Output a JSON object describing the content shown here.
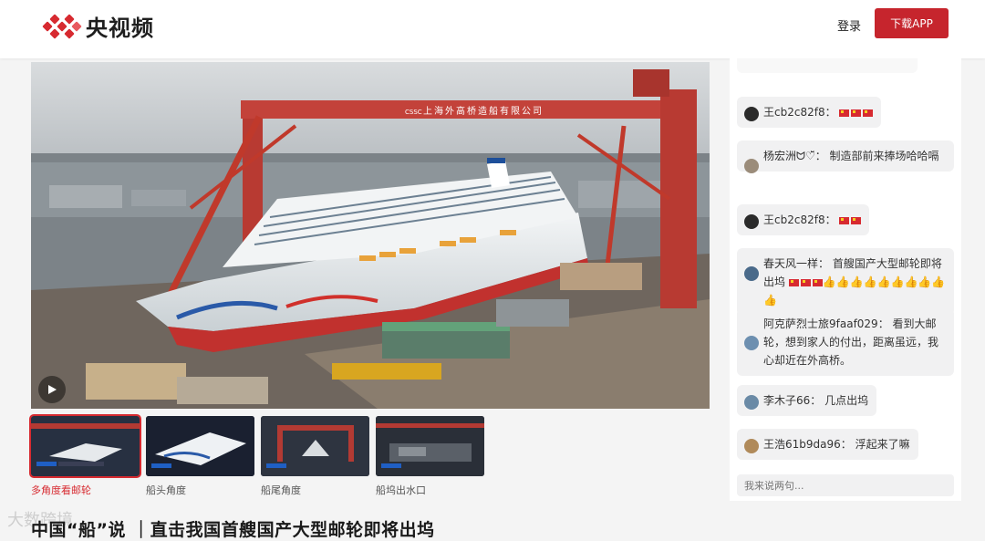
{
  "header": {
    "logo_text": "央视频",
    "login_label": "登录",
    "download_label": "下载APP"
  },
  "player": {
    "sign_text": "上海外高桥造船有限公司",
    "cssc_text": "CSSC"
  },
  "thumbnails": [
    {
      "caption": "多角度看邮轮",
      "active": true
    },
    {
      "caption": "船头角度",
      "active": false
    },
    {
      "caption": "船尾角度",
      "active": false
    },
    {
      "caption": "船坞出水口",
      "active": false
    }
  ],
  "video_title": "中国“船”说 ｜直击我国首艘国产大型邮轮即将出坞",
  "watermark": "大数跨境",
  "chat": {
    "top_partial": "",
    "messages": [
      {
        "user": "王cb2c82f8：",
        "text": "",
        "flags": 3,
        "thumbs": 0
      },
      {
        "user": "杨宏洲ᗢ♡̆̈：",
        "text": "制造部前来捧场哈哈嗝",
        "flags": 0,
        "thumbs": 0
      },
      {
        "user": "王cb2c82f8：",
        "text": "",
        "flags": 2,
        "thumbs": 0
      },
      {
        "user": "春天风一样：",
        "text": "首艘国产大型邮轮即将出坞",
        "flags": 3,
        "thumbs": 10
      },
      {
        "user": "阿克萨烈士旅9faaf029：",
        "text": "看到大邮轮，想到家人的付出，距离虽远，我心却近在外高桥。",
        "flags": 0,
        "thumbs": 0
      },
      {
        "user": "李木子66：",
        "text": "几点出坞",
        "flags": 0,
        "thumbs": 0
      },
      {
        "user": "王浩61b9da96：",
        "text": "浮起来了嘛",
        "flags": 0,
        "thumbs": 0
      }
    ],
    "input_placeholder": "我来说两句..."
  }
}
